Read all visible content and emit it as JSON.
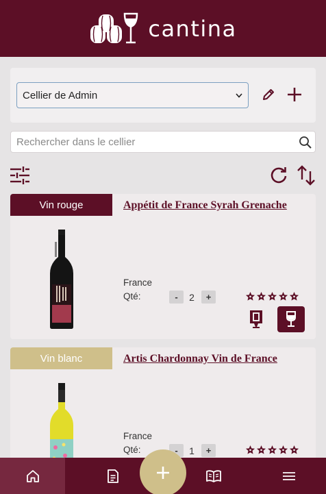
{
  "app": {
    "name": "cantina"
  },
  "cellar": {
    "selected": "Cellier de Admin"
  },
  "search": {
    "placeholder": "Rechercher dans le cellier"
  },
  "wines": [
    {
      "type": "Vin rouge",
      "type_color": "#5c0f26",
      "name": "Appétit de France Syrah Grenache",
      "country": "France",
      "qty_label": "Qté:",
      "quantity": "2",
      "rating": 0,
      "rating_max": 5
    },
    {
      "type": "Vin blanc",
      "type_color": "#cfbf8a",
      "name": "Artis Chardonnay Vin de France",
      "country": "France",
      "qty_label": "Qté:",
      "quantity": "1",
      "rating": 0,
      "rating_max": 5
    }
  ],
  "qty_controls": {
    "minus": "-",
    "plus": "+"
  },
  "nav": [
    "home-icon",
    "document-icon",
    "add-icon",
    "book-icon",
    "menu-icon"
  ],
  "colors": {
    "primary": "#5c0f26",
    "gold": "#cfbf8a",
    "background": "#e6e4e5"
  }
}
